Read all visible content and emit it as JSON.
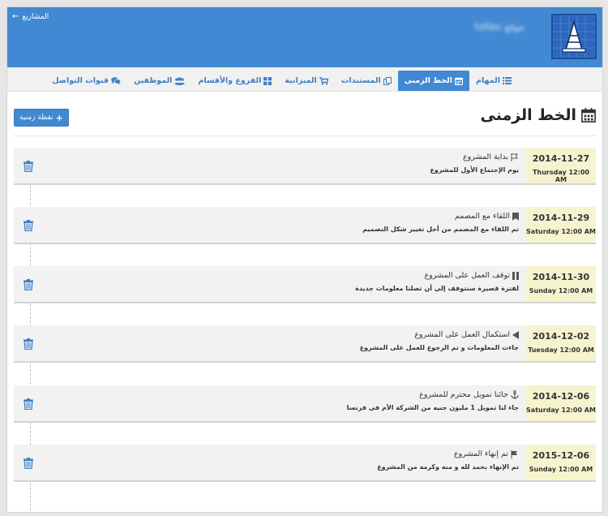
{
  "header": {
    "back_label": "المشاريع",
    "project_name": "موقع tollav",
    "brand_color": "#4289d3"
  },
  "tabs": [
    {
      "label": "المهام",
      "icon": "list-icon",
      "active": false
    },
    {
      "label": "الخط الزمنى",
      "icon": "calendar-icon",
      "active": true
    },
    {
      "label": "المستندات",
      "icon": "documents-icon",
      "active": false
    },
    {
      "label": "الميزانية",
      "icon": "cart-icon",
      "active": false
    },
    {
      "label": "الفروع والأقسام",
      "icon": "grid-icon",
      "active": false
    },
    {
      "label": "الموظفين",
      "icon": "users-icon",
      "active": false
    },
    {
      "label": "قنوات التواصل",
      "icon": "comments-icon",
      "active": false
    }
  ],
  "page": {
    "title": "الخط الزمنى",
    "add_button_label": "نقطة زمنية"
  },
  "entries": [
    {
      "date": "2014-11-27",
      "day": "Thursday 12:00 AM",
      "title": "بداية المشروع",
      "icon": "flag-outline-icon",
      "description": "يوم الإجتماع الأول للمشروع"
    },
    {
      "date": "2014-11-29",
      "day": "Saturday 12:00 AM",
      "title": "اللقاء مع المصمم",
      "icon": "bookmark-icon",
      "description": "تم اللقاء مع المصمم من أجل تغيير شكل التصميم"
    },
    {
      "date": "2014-11-30",
      "day": "Sunday 12:00 AM",
      "title": "توقف العمل على المشروع",
      "icon": "pause-icon",
      "description": "لفترة قصيرة سنتوقف إلى أن تصلنا معلومات جديدة"
    },
    {
      "date": "2014-12-02",
      "day": "Tuesday 12:00 AM",
      "title": "استكمال العمل على المشروع",
      "icon": "play-icon",
      "description": "جاءت المعلومات و تم الرجوع للعمل على المشروع"
    },
    {
      "date": "2014-12-06",
      "day": "Saturday 12:00 AM",
      "title": "جائنا تمويل محترم للمشروع",
      "icon": "anchor-icon",
      "description": "جاء لنا تمويل 1 مليون جنيه من الشركة الأم فى فرنسا"
    },
    {
      "date": "2015-12-06",
      "day": "Sunday 12:00 AM",
      "title": "تم إنهاء المشروع",
      "icon": "flag-icon",
      "description": "تم الإنهاء بحمد لله و منه وكرمه من المشروع"
    }
  ]
}
